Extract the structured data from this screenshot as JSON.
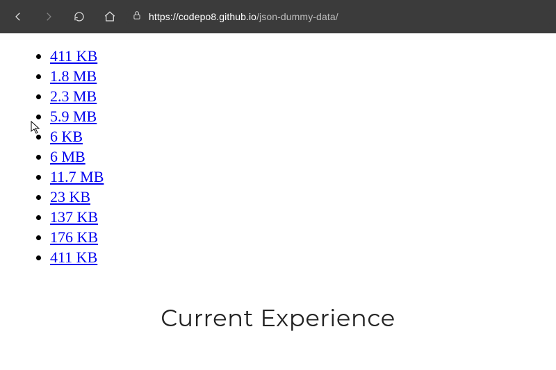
{
  "browser": {
    "url_host": "https://codepo8.github.io",
    "url_path": "/json-dummy-data/"
  },
  "links": [
    {
      "label": "411 KB"
    },
    {
      "label": "1.8 MB"
    },
    {
      "label": "2.3 MB"
    },
    {
      "label": "5.9 MB"
    },
    {
      "label": "6 KB"
    },
    {
      "label": "6 MB"
    },
    {
      "label": "11.7 MB"
    },
    {
      "label": "23 KB"
    },
    {
      "label": "137 KB"
    },
    {
      "label": "176 KB"
    },
    {
      "label": "411 KB"
    }
  ],
  "heading": "Current Experience"
}
